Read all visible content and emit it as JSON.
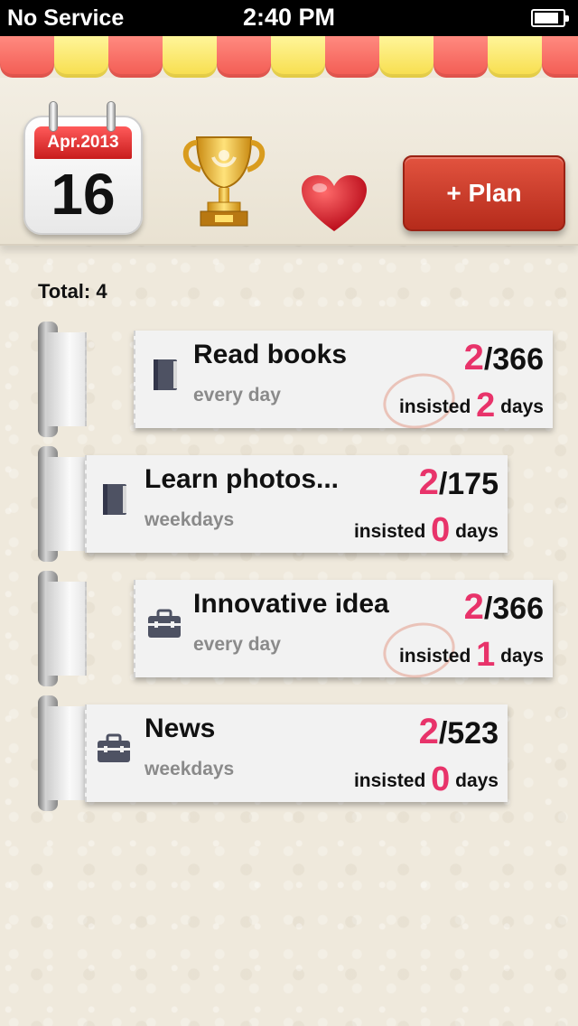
{
  "status_bar": {
    "carrier": "No Service",
    "time": "2:40 PM"
  },
  "header": {
    "calendar": {
      "month_year": "Apr.2013",
      "day": "16"
    },
    "plan_button_label": "+ Plan"
  },
  "summary": {
    "total_label": "Total: 4"
  },
  "plans": [
    {
      "title": "Read books",
      "frequency": "every day",
      "done": "2",
      "total": "/366",
      "insisted_label": "insisted",
      "streak": "2",
      "days_label": "days",
      "icon": "book-icon",
      "stamped": true
    },
    {
      "title": "Learn photos...",
      "frequency": "weekdays",
      "done": "2",
      "total": "/175",
      "insisted_label": "insisted",
      "streak": "0",
      "days_label": "days",
      "icon": "book-icon",
      "stamped": false
    },
    {
      "title": "Innovative idea",
      "frequency": "every day",
      "done": "2",
      "total": "/366",
      "insisted_label": "insisted",
      "streak": "1",
      "days_label": "days",
      "icon": "briefcase-icon",
      "stamped": true
    },
    {
      "title": "News",
      "frequency": "weekdays",
      "done": "2",
      "total": "/523",
      "insisted_label": "insisted",
      "streak": "0",
      "days_label": "days",
      "icon": "briefcase-icon",
      "stamped": false
    }
  ],
  "colors": {
    "accent_pink": "#e8336a",
    "plan_button_red": "#c23a28",
    "awning_red": "#f25a52",
    "awning_yellow": "#f7dd4a"
  }
}
